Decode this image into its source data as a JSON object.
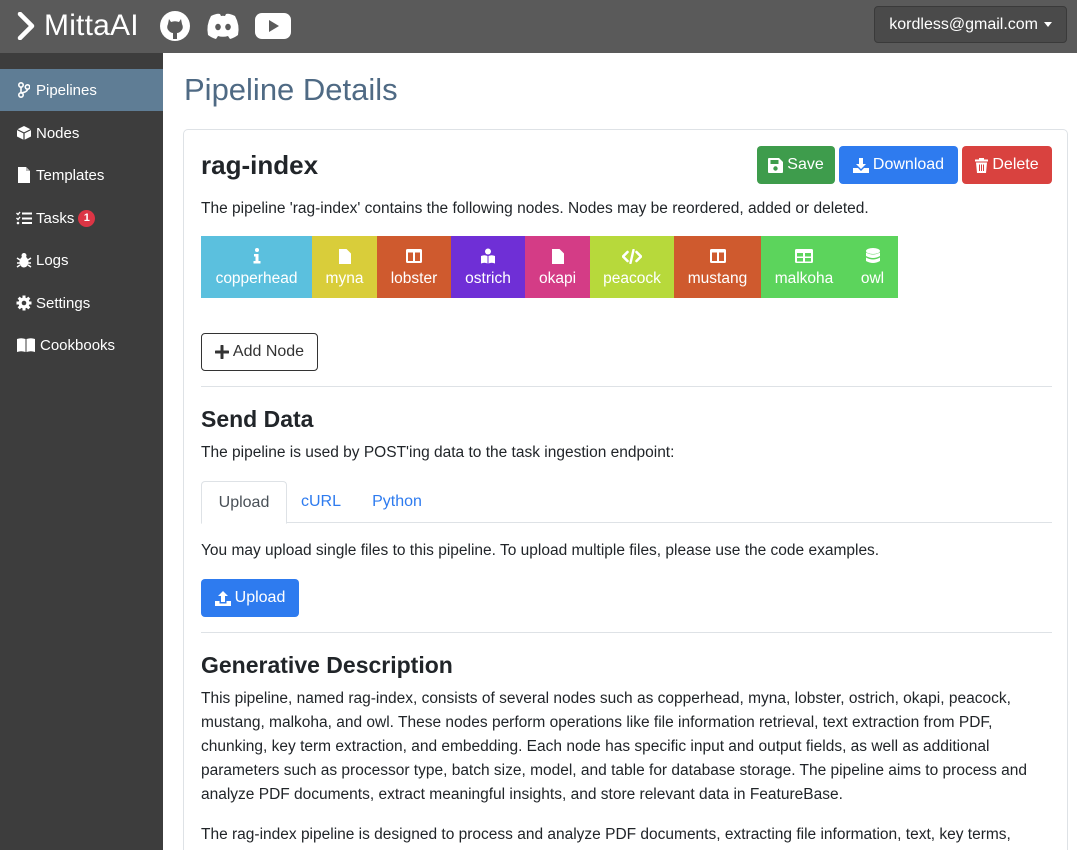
{
  "brand": {
    "name": "MittaAI",
    "icons": [
      "github-icon",
      "discord-icon",
      "youtube-icon"
    ]
  },
  "user": {
    "email": "kordless@gmail.com"
  },
  "sidebar": {
    "items": [
      {
        "label": "Pipelines",
        "icon": "branch-icon",
        "active": true
      },
      {
        "label": "Nodes",
        "icon": "cube-icon"
      },
      {
        "label": "Templates",
        "icon": "file-icon"
      },
      {
        "label": "Tasks",
        "icon": "task-list-icon",
        "badge": "1"
      },
      {
        "label": "Logs",
        "icon": "bug-icon"
      },
      {
        "label": "Settings",
        "icon": "gear-icon"
      },
      {
        "label": "Cookbooks",
        "icon": "book-icon"
      }
    ]
  },
  "page": {
    "title": "Pipeline Details"
  },
  "pipeline": {
    "name": "rag-index",
    "description": "The pipeline 'rag-index' contains the following nodes. Nodes may be reordered, added or deleted.",
    "buttons": {
      "save": "Save",
      "download": "Download",
      "delete": "Delete"
    },
    "nodes": [
      {
        "label": "copperhead",
        "icon": "info-icon",
        "color": "#5bc0de"
      },
      {
        "label": "myna",
        "icon": "file-icon",
        "color": "#d9cd3a"
      },
      {
        "label": "lobster",
        "icon": "columns-icon",
        "color": "#cf5a2e"
      },
      {
        "label": "ostrich",
        "icon": "user-book-icon",
        "color": "#6f2fd6"
      },
      {
        "label": "okapi",
        "icon": "file-icon",
        "color": "#d43c86"
      },
      {
        "label": "peacock",
        "icon": "code-icon",
        "color": "#b7d93b"
      },
      {
        "label": "mustang",
        "icon": "columns-icon",
        "color": "#cf5a2e"
      },
      {
        "label": "malkoha",
        "icon": "table-icon",
        "color": "#5cd45c"
      },
      {
        "label": "owl",
        "icon": "database-icon",
        "color": "#5cd45c"
      }
    ],
    "add_node": "Add Node"
  },
  "send_data": {
    "heading": "Send Data",
    "intro": "The pipeline is used by POST'ing data to the task ingestion endpoint:",
    "tabs": [
      {
        "label": "Upload",
        "active": true
      },
      {
        "label": "cURL"
      },
      {
        "label": "Python"
      }
    ],
    "upload_text": "You may upload single files to this pipeline. To upload multiple files, please use the code examples.",
    "upload_button": "Upload"
  },
  "generative": {
    "heading": "Generative Description",
    "para1": "This pipeline, named rag-index, consists of several nodes such as copperhead, myna, lobster, ostrich, okapi, peacock, mustang, malkoha, and owl. These nodes perform operations like file information retrieval, text extraction from PDF, chunking, key term extraction, and embedding. Each node has specific input and output fields, as well as additional parameters such as processor type, batch size, model, and table for database storage. The pipeline aims to process and analyze PDF documents, extract meaningful insights, and store relevant data in FeatureBase.",
    "para2": "The rag-index pipeline is designed to process and analyze PDF documents, extracting file information, text, key terms,"
  }
}
